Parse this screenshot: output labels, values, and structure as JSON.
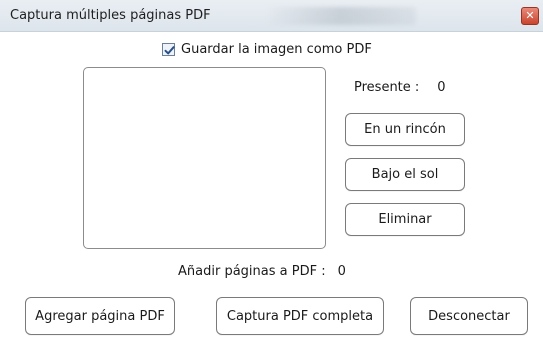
{
  "window": {
    "title": "Captura múltiples páginas PDF",
    "close_symbol": "✕"
  },
  "checkbox": {
    "label": "Guardar la imagen como PDF",
    "checked": true
  },
  "present": {
    "label": "Presente :",
    "value": "0"
  },
  "side_buttons": {
    "corner": "En un rincón",
    "sun": "Bajo el sol",
    "delete": "Eliminar"
  },
  "add_pages": {
    "label": "Añadir páginas a PDF :",
    "value": "0"
  },
  "bottom_buttons": {
    "add_page": "Agregar página PDF",
    "full_capture": "Captura PDF completa",
    "disconnect": "Desconectar"
  },
  "colors": {
    "titlebar": "#dde5ec",
    "close_button": "#c9452f",
    "checkmark": "#2a4f86"
  }
}
